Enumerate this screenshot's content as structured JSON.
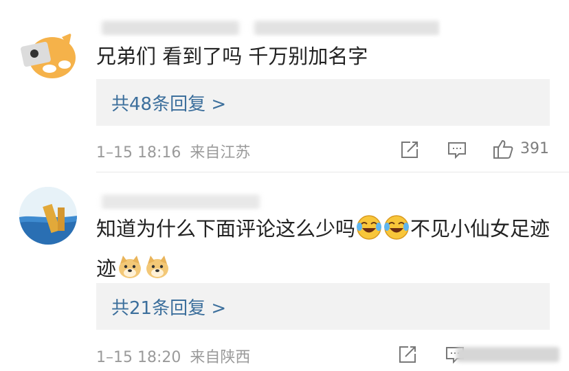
{
  "comments": [
    {
      "text": "兄弟们 看到了吗 千万别加名字",
      "reply_label": "共48条回复 >",
      "time": "1–15 18:16",
      "location": "来自江苏",
      "likes": "391"
    },
    {
      "text_a": "知道为什么下面评论这么少吗",
      "text_b": "不见小仙女足迹",
      "reply_label": "共21条回复 >",
      "time": "1–15 18:20",
      "location": "来自陕西"
    }
  ],
  "colors": {
    "reply_link": "#3c6f9c",
    "reply_bg": "#f2f2f2",
    "meta_text": "#9a9a9a",
    "body_text": "#222222"
  },
  "icons": [
    "share-icon",
    "comment-icon",
    "thumbs-up-icon",
    "cry-laugh-emoji",
    "doge-emoji"
  ]
}
